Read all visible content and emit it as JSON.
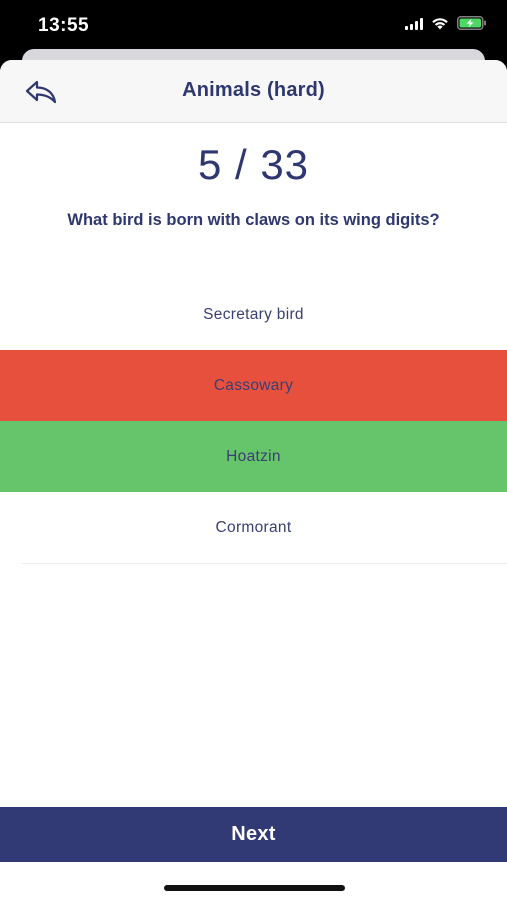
{
  "status_bar": {
    "time": "13:55",
    "icons": [
      "cellular-signal-icon",
      "wifi-icon",
      "battery-charging-icon"
    ],
    "battery_color": "#4cd964"
  },
  "nav": {
    "back_icon": "back-arrow-icon",
    "title": "Animals (hard)"
  },
  "quiz": {
    "progress": "5 / 33",
    "question": "What bird is born with claws on its wing digits?",
    "answers": [
      {
        "label": "Secretary bird",
        "state": "neutral"
      },
      {
        "label": "Cassowary",
        "state": "wrong"
      },
      {
        "label": "Hoatzin",
        "state": "correct"
      },
      {
        "label": "Cormorant",
        "state": "neutral"
      }
    ]
  },
  "colors": {
    "primary": "#313a74",
    "wrong": "#e8503e",
    "correct": "#66c46b"
  },
  "footer": {
    "next_label": "Next"
  }
}
